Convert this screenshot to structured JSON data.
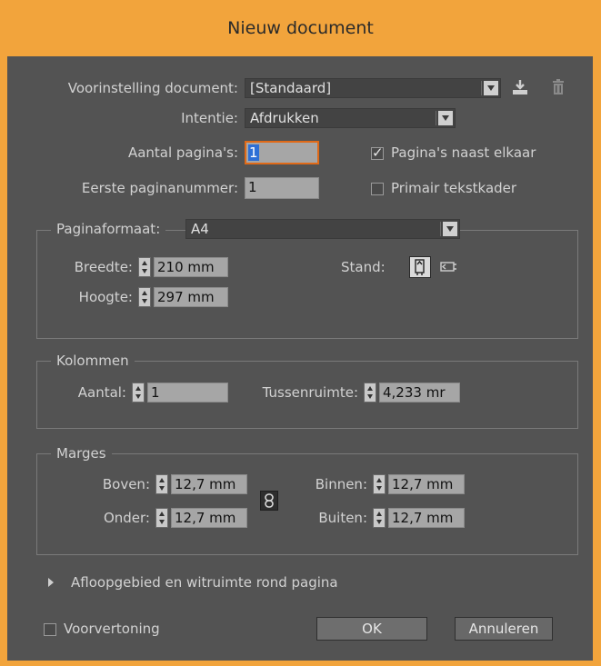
{
  "title": "Nieuw document",
  "preset": {
    "label": "Voorinstelling document:",
    "value": "[Standaard]"
  },
  "intent": {
    "label": "Intentie:",
    "value": "Afdrukken"
  },
  "pages": {
    "label": "Aantal pagina's:",
    "value": "1"
  },
  "first_page": {
    "label": "Eerste paginanummer:",
    "value": "1"
  },
  "facing": {
    "label": "Pagina's naast elkaar",
    "checked": true
  },
  "primary_frame": {
    "label": "Primair tekstkader",
    "checked": false
  },
  "page_size": {
    "label": "Paginaformaat:",
    "value": "A4",
    "width_label": "Breedte:",
    "width_value": "210 mm",
    "height_label": "Hoogte:",
    "height_value": "297 mm",
    "orientation_label": "Stand:"
  },
  "columns": {
    "title": "Kolommen",
    "count_label": "Aantal:",
    "count_value": "1",
    "gutter_label": "Tussenruimte:",
    "gutter_value": "4,233 mr"
  },
  "margins": {
    "title": "Marges",
    "top_label": "Boven:",
    "top_value": "12,7 mm",
    "bottom_label": "Onder:",
    "bottom_value": "12,7 mm",
    "inside_label": "Binnen:",
    "inside_value": "12,7 mm",
    "outside_label": "Buiten:",
    "outside_value": "12,7 mm"
  },
  "bleed": {
    "label": "Afloopgebied en witruimte rond pagina"
  },
  "preview": {
    "label": "Voorvertoning",
    "checked": false
  },
  "buttons": {
    "ok": "OK",
    "cancel": "Annuleren"
  },
  "colors": {
    "title_bar": "#f2a43c",
    "panel": "#535353",
    "focus": "#e06a18"
  }
}
